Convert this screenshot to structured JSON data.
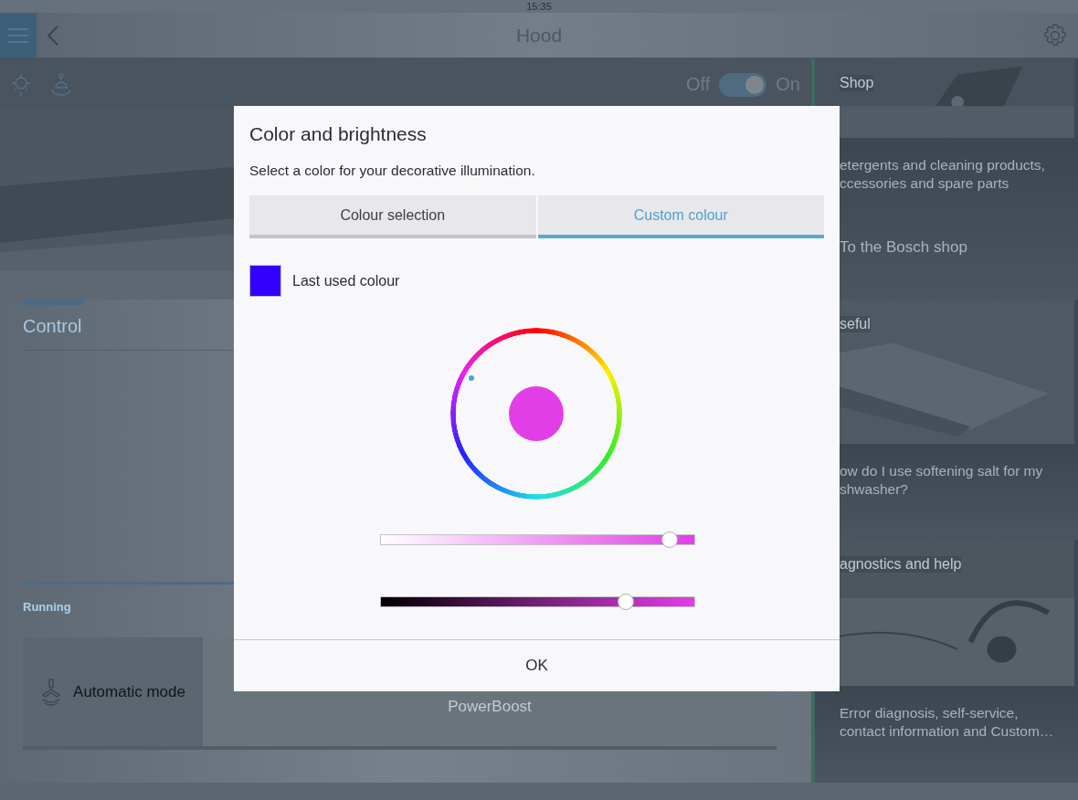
{
  "status_bar": {
    "time": "15:35"
  },
  "nav_bar": {
    "title": "Hood"
  },
  "power": {
    "off_label": "Off",
    "on_label": "On",
    "on": true
  },
  "control": {
    "tab": "Control",
    "section": "Running",
    "programs": [
      "Automatic mode",
      "PowerBoost"
    ]
  },
  "sidebar": {
    "sections": [
      {
        "header": "Shop",
        "lines": [
          "etergents and cleaning products,",
          "ccessories and spare parts"
        ],
        "link": "To the Bosch shop"
      },
      {
        "header": "seful",
        "lines": [
          "ow do I use softening salt for my",
          "shwasher?"
        ]
      },
      {
        "header": "agnostics and help",
        "lines": [
          "Error diagnosis, self-service,",
          "contact information and Custom…"
        ]
      }
    ]
  },
  "dialog": {
    "title": "Color and brightness",
    "subtitle": "Select a color for your decorative illumination.",
    "tabs": [
      {
        "label": "Colour selection",
        "selected": false
      },
      {
        "label": "Custom colour",
        "selected": true
      }
    ],
    "last_used": {
      "label": "Last used colour",
      "color": "#3300ff"
    },
    "current": {
      "color": "#e23ee8"
    },
    "sliders": [
      {
        "kind": "saturation",
        "level": 0.92
      },
      {
        "kind": "brightness",
        "level": 0.78
      }
    ],
    "button": "OK"
  }
}
